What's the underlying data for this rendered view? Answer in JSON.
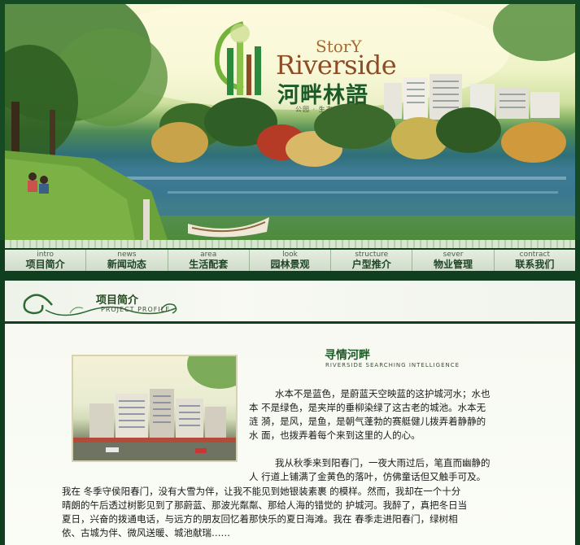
{
  "logo": {
    "story": "StorY",
    "name_en": "Riverside",
    "name_cn": "河畔林語",
    "tagline": "公园 · 生态 · 家"
  },
  "nav": {
    "items": [
      {
        "en": "intro",
        "cn": "项目简介"
      },
      {
        "en": "news",
        "cn": "新闻动态"
      },
      {
        "en": "area",
        "cn": "生活配套"
      },
      {
        "en": "look",
        "cn": "园林景观"
      },
      {
        "en": "structure",
        "cn": "户型推介"
      },
      {
        "en": "sever",
        "cn": "物业管理"
      },
      {
        "en": "contract",
        "cn": "联系我们"
      }
    ]
  },
  "section": {
    "title": "项目简介",
    "title_en": "PROJECT PROFILE"
  },
  "article": {
    "title": "寻情河畔",
    "title_en": "RIVERSIDE SEARCHING INTELLIGENCE",
    "p1_lines": [
      "水本不是蓝色，是蔚蓝天空映蓝的这护城河水；水也",
      "本 不是绿色，是夹岸的垂柳染绿了这古老的城池。水本无",
      "涟 漪，是风，是鱼，是朝气蓬勃的赛艇健儿拨弄着静静的",
      "水 面，也拨弄着每个来到这里的人的心。"
    ],
    "p2_lines": [
      "我从秋季来到阳春门，一夜大雨过后，笔直而幽静的",
      "人 行道上铺满了金黄色的落叶，仿佛童话但又触手可及。"
    ],
    "p3_lines": [
      "我在  冬季守侯阳春门，没有大雪为伴，让我不能见到她银装素裹 的模样。然而，我却在一个十分",
      "晴朗的午后透过树影见到了那蔚蓝、那波光粼粼、那给人海的错觉的  护城河。我醉了，真把冬日当",
      "夏日，兴奋的拨通电话，与远方的朋友回忆着那快乐的夏日海滩。我在  春季走进阳春门，绿树相",
      "依、古城为伴、微风送暖、城池献瑞……"
    ]
  },
  "colors": {
    "frame": "#0f3f1e",
    "title_green": "#1f5b28",
    "logo_brown": "#8b4c26"
  }
}
